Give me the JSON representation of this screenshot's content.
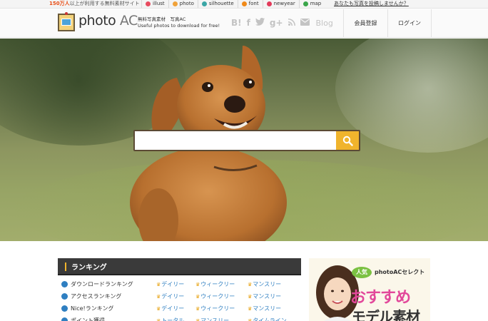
{
  "topbar": {
    "tagline_num": "150万人",
    "tagline_rest": "以上が利用する無料素材サイト",
    "sites": [
      {
        "label": "illust",
        "icon": "illust-icon",
        "color": "#e84b5f"
      },
      {
        "label": "photo",
        "icon": "photo-icon",
        "color": "#f0a23a"
      },
      {
        "label": "silhouette",
        "icon": "silhouette-icon",
        "color": "#3aa6a6"
      },
      {
        "label": "font",
        "icon": "font-icon",
        "color": "#f08a1a"
      },
      {
        "label": "newyear",
        "icon": "newyear-icon",
        "color": "#e23a5a"
      },
      {
        "label": "map",
        "icon": "map-icon",
        "color": "#3aa64a"
      }
    ],
    "post_link": "あなたも写真を投稿しませんか？"
  },
  "header": {
    "logo_main": "photo",
    "logo_ac": "AC",
    "logo_sub1": "無料写真素材　写真AC",
    "logo_sub2": "Useful photos to download for free!",
    "social": [
      "hatena-bookmark-icon",
      "facebook-icon",
      "twitter-icon",
      "google-plus-icon",
      "rss-icon",
      "mail-icon"
    ],
    "blog_label": "Blog",
    "register_label": "会員登録",
    "login_label": "ログイン"
  },
  "search": {
    "placeholder": "",
    "button_icon": "search-icon",
    "accent": "#f0b42d"
  },
  "ranking": {
    "title": "ランキング",
    "rows": [
      {
        "name": "ダウンロードランキング",
        "links": [
          "デイリー",
          "ウィークリー",
          "マンスリー"
        ]
      },
      {
        "name": "アクセスランキング",
        "links": [
          "デイリー",
          "ウィークリー",
          "マンスリー"
        ]
      },
      {
        "name": "Nice!ランキング",
        "links": [
          "デイリー",
          "ウィークリー",
          "マンスリー"
        ]
      },
      {
        "name": "ポイント獲得",
        "links": [
          "トータル",
          "マンスリー",
          "タイムライン"
        ]
      }
    ]
  },
  "banner": {
    "ninki": "人気",
    "brand": "photoACセレクト",
    "headline": "おすすめ",
    "subline": "モデル素材"
  }
}
